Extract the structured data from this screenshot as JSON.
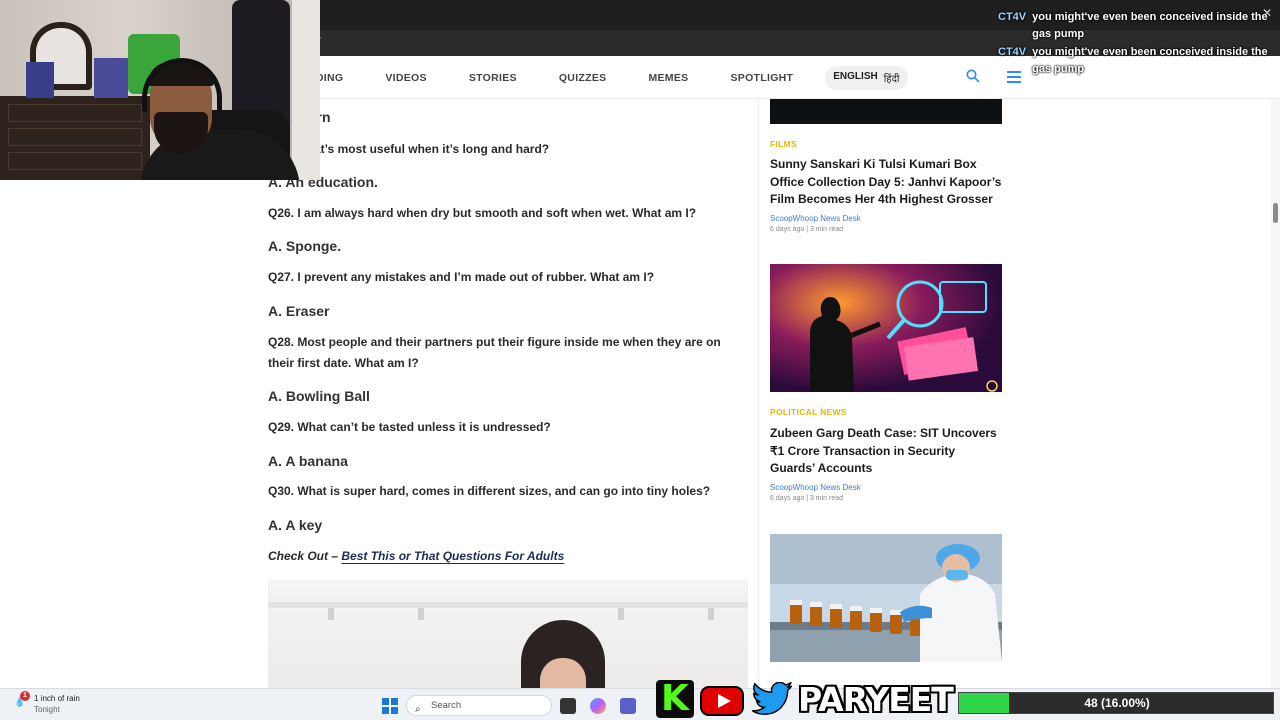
{
  "browser": {
    "address_fragment": "s/"
  },
  "nav": {
    "items": [
      "NDING",
      "VIDEOS",
      "STORIES",
      "QUIZZES",
      "MEMES",
      "SPOTLIGHT"
    ],
    "lang_english": "ENGLISH",
    "lang_hindi": "हिंदी"
  },
  "article": {
    "partial_answer": "orn",
    "qa": [
      {
        "type": "q",
        "text": "at’s most useful when it’s long and hard?"
      },
      {
        "type": "a",
        "text": "A. An education."
      },
      {
        "type": "q",
        "text": "Q26. I am always hard when dry but smooth and soft when wet. What am I?"
      },
      {
        "type": "a",
        "text": "A. Sponge."
      },
      {
        "type": "q",
        "text": "Q27. I prevent any mistakes and I’m made out of rubber. What am I?"
      },
      {
        "type": "a",
        "text": "A. Eraser"
      },
      {
        "type": "q",
        "text": "Q28. Most people and their partners put their figure inside me when they are on their first date. What am I?"
      },
      {
        "type": "a",
        "text": "A. Bowling Ball"
      },
      {
        "type": "q",
        "text": "Q29. What can’t be tasted unless it is undressed?"
      },
      {
        "type": "a",
        "text": "A. A banana"
      },
      {
        "type": "q",
        "text": "Q30. What is super hard, comes in different sizes, and can go into tiny holes?"
      },
      {
        "type": "a",
        "text": "A. A key"
      }
    ],
    "checkout_prefix": "Check Out – ",
    "checkout_link": "Best This or That Questions For Adults"
  },
  "sidebar": {
    "cards": [
      {
        "category": "FILMS",
        "headline": "Sunny Sanskari Ki Tulsi Kumari Box Office Collection Day 5: Janhvi Kapoor’s Film Becomes Her 4th Highest Grosser",
        "author": "ScoopWhoop News Desk",
        "meta": "6 days ago | 3 min read"
      },
      {
        "category": "POLITICAL NEWS",
        "headline": "Zubeen Garg Death Case: SIT Uncovers ₹1 Crore Transaction in Security Guards’ Accounts",
        "author": "ScoopWhoop News Desk",
        "meta": "6 days ago | 3 min read"
      }
    ]
  },
  "chat": {
    "messages": [
      {
        "user": "CT4V",
        "text": "you might've even been conceived inside the gas pump"
      },
      {
        "user": "CT4V",
        "text": "you might've even been conceived inside the gas pump"
      }
    ]
  },
  "taskbar": {
    "weather_badge": "1",
    "weather_title": "1 inch of rain",
    "weather_sub": "Tonight",
    "search_placeholder": "Search"
  },
  "overlay": {
    "brand": "PARYEET",
    "kick_letter": "K",
    "progress_label": "48 (16.00%)",
    "progress_fraction": 0.16
  },
  "colors": {
    "accent": "#2d8cff",
    "category": "#e4b800",
    "author": "#3d7bd9",
    "progress": "#2fd64a"
  }
}
